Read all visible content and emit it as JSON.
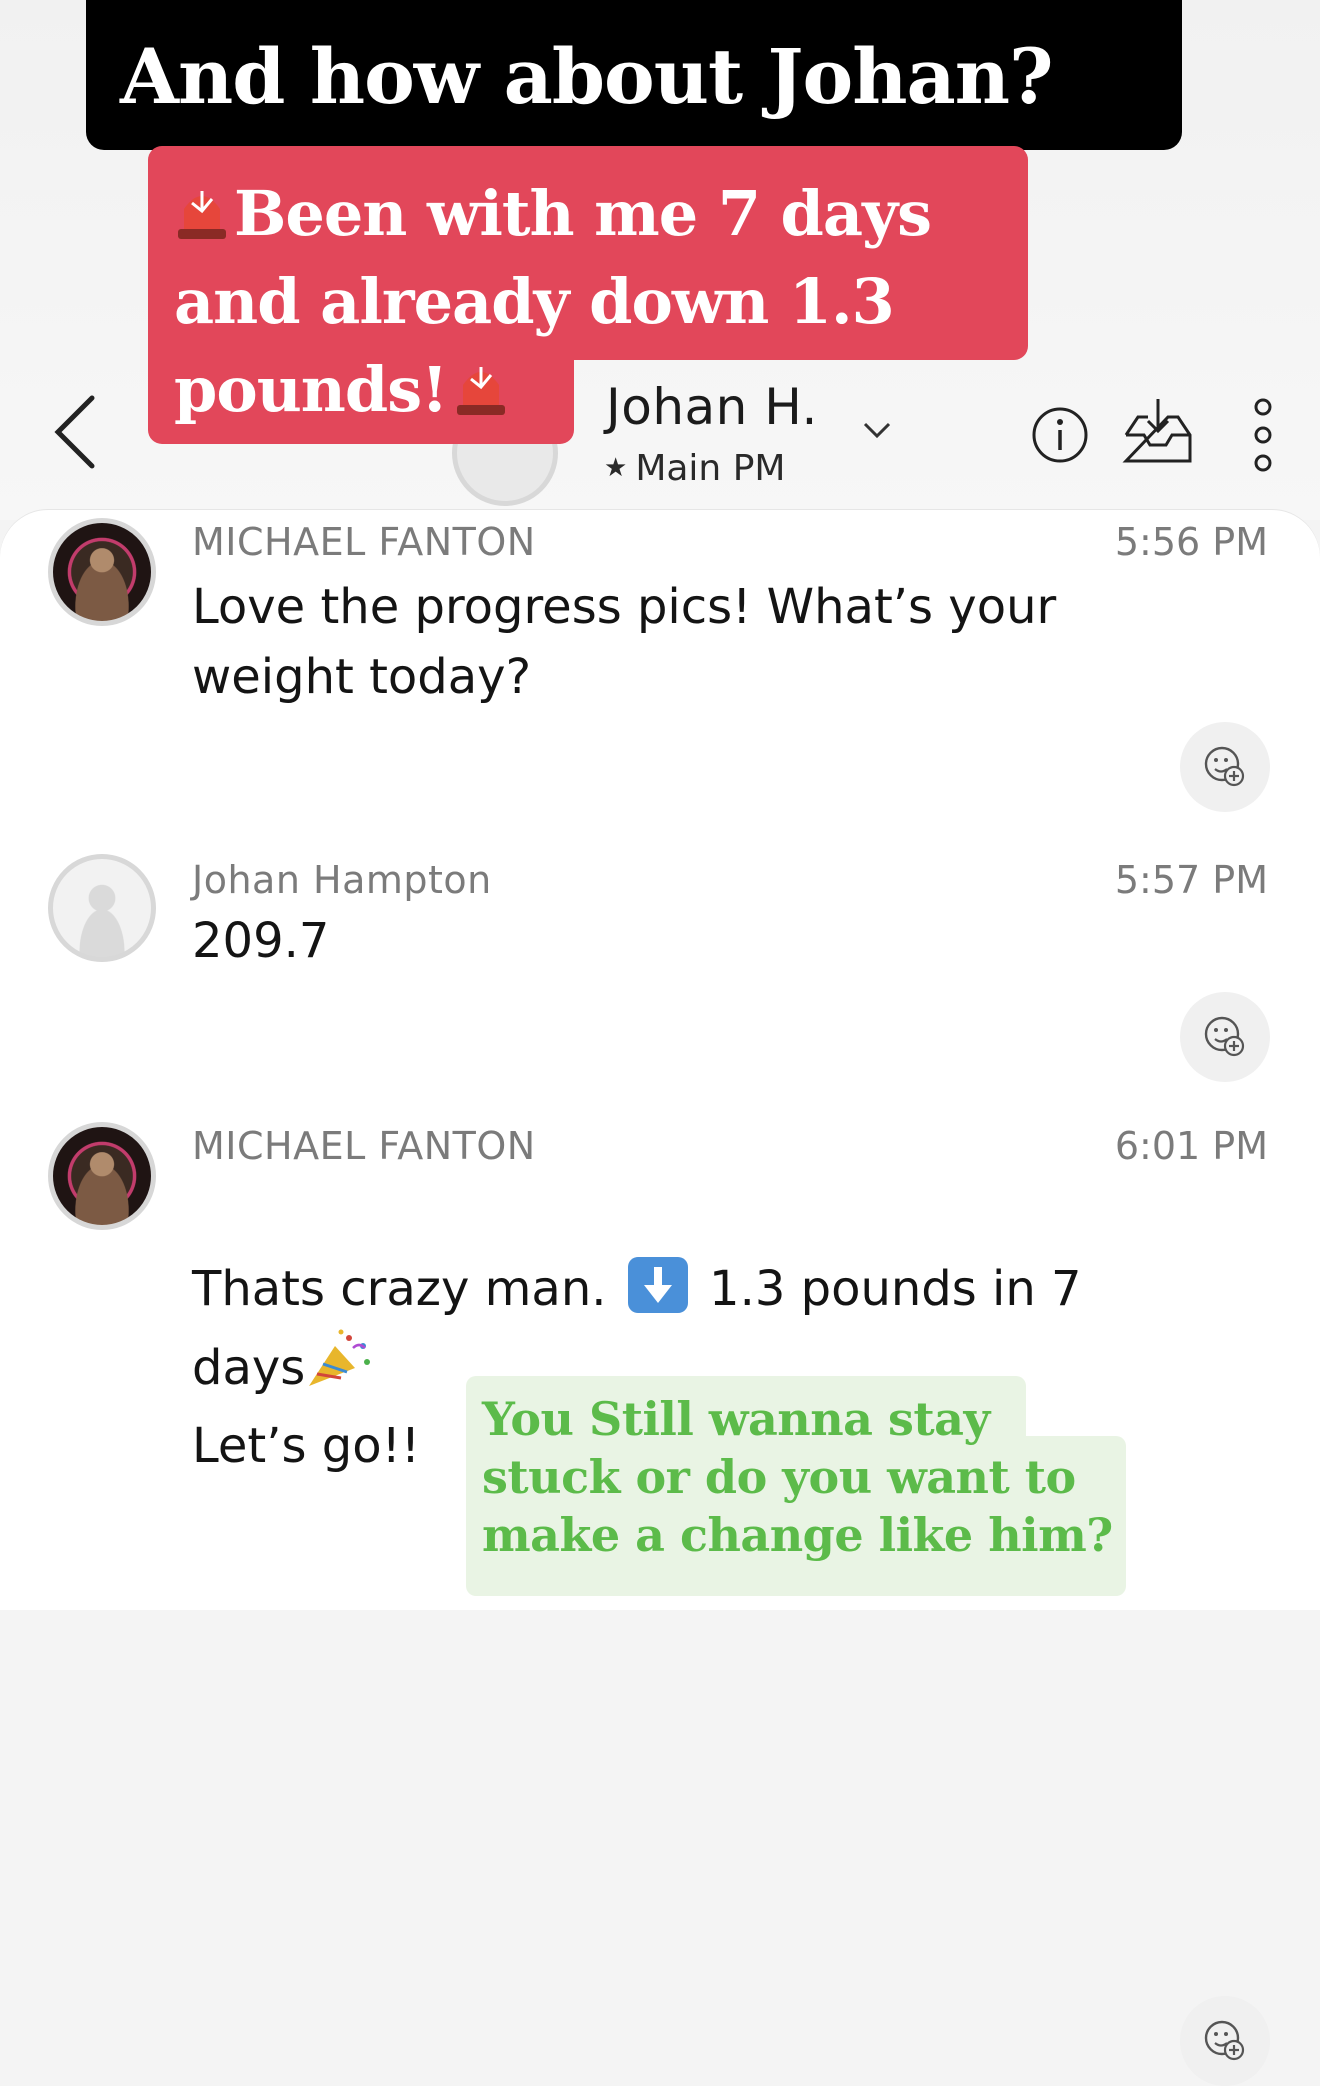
{
  "overlay": {
    "title": "And how about Johan?",
    "highlight": "Been with me 7 days and already down 1.3 pounds!",
    "footer_note": "You Still wanna stay stuck or do you want to make a change like him?",
    "highlight_color": "#e2475a",
    "footer_color": "#5cbb4a"
  },
  "header": {
    "contact_name": "Johan H.",
    "subtitle": "Main PM",
    "icons": [
      "back-chevron-icon",
      "chevron-down-icon",
      "info-icon",
      "inbox-download-icon",
      "more-vertical-icon"
    ]
  },
  "messages": [
    {
      "sender": "MICHAEL FANTON",
      "time": "5:56 PM",
      "text_line1": "Love the progress pics! What’s your",
      "text_line2": "weight today?"
    },
    {
      "sender": "Johan Hampton",
      "time": "5:57 PM",
      "text": "209.7"
    },
    {
      "sender": "MICHAEL FANTON",
      "time": "6:01 PM",
      "text_part1": "Thats crazy man.",
      "text_part2": "1.3 pounds in 7",
      "text_part3": "days",
      "text_part4": "Let’s go!!"
    }
  ]
}
